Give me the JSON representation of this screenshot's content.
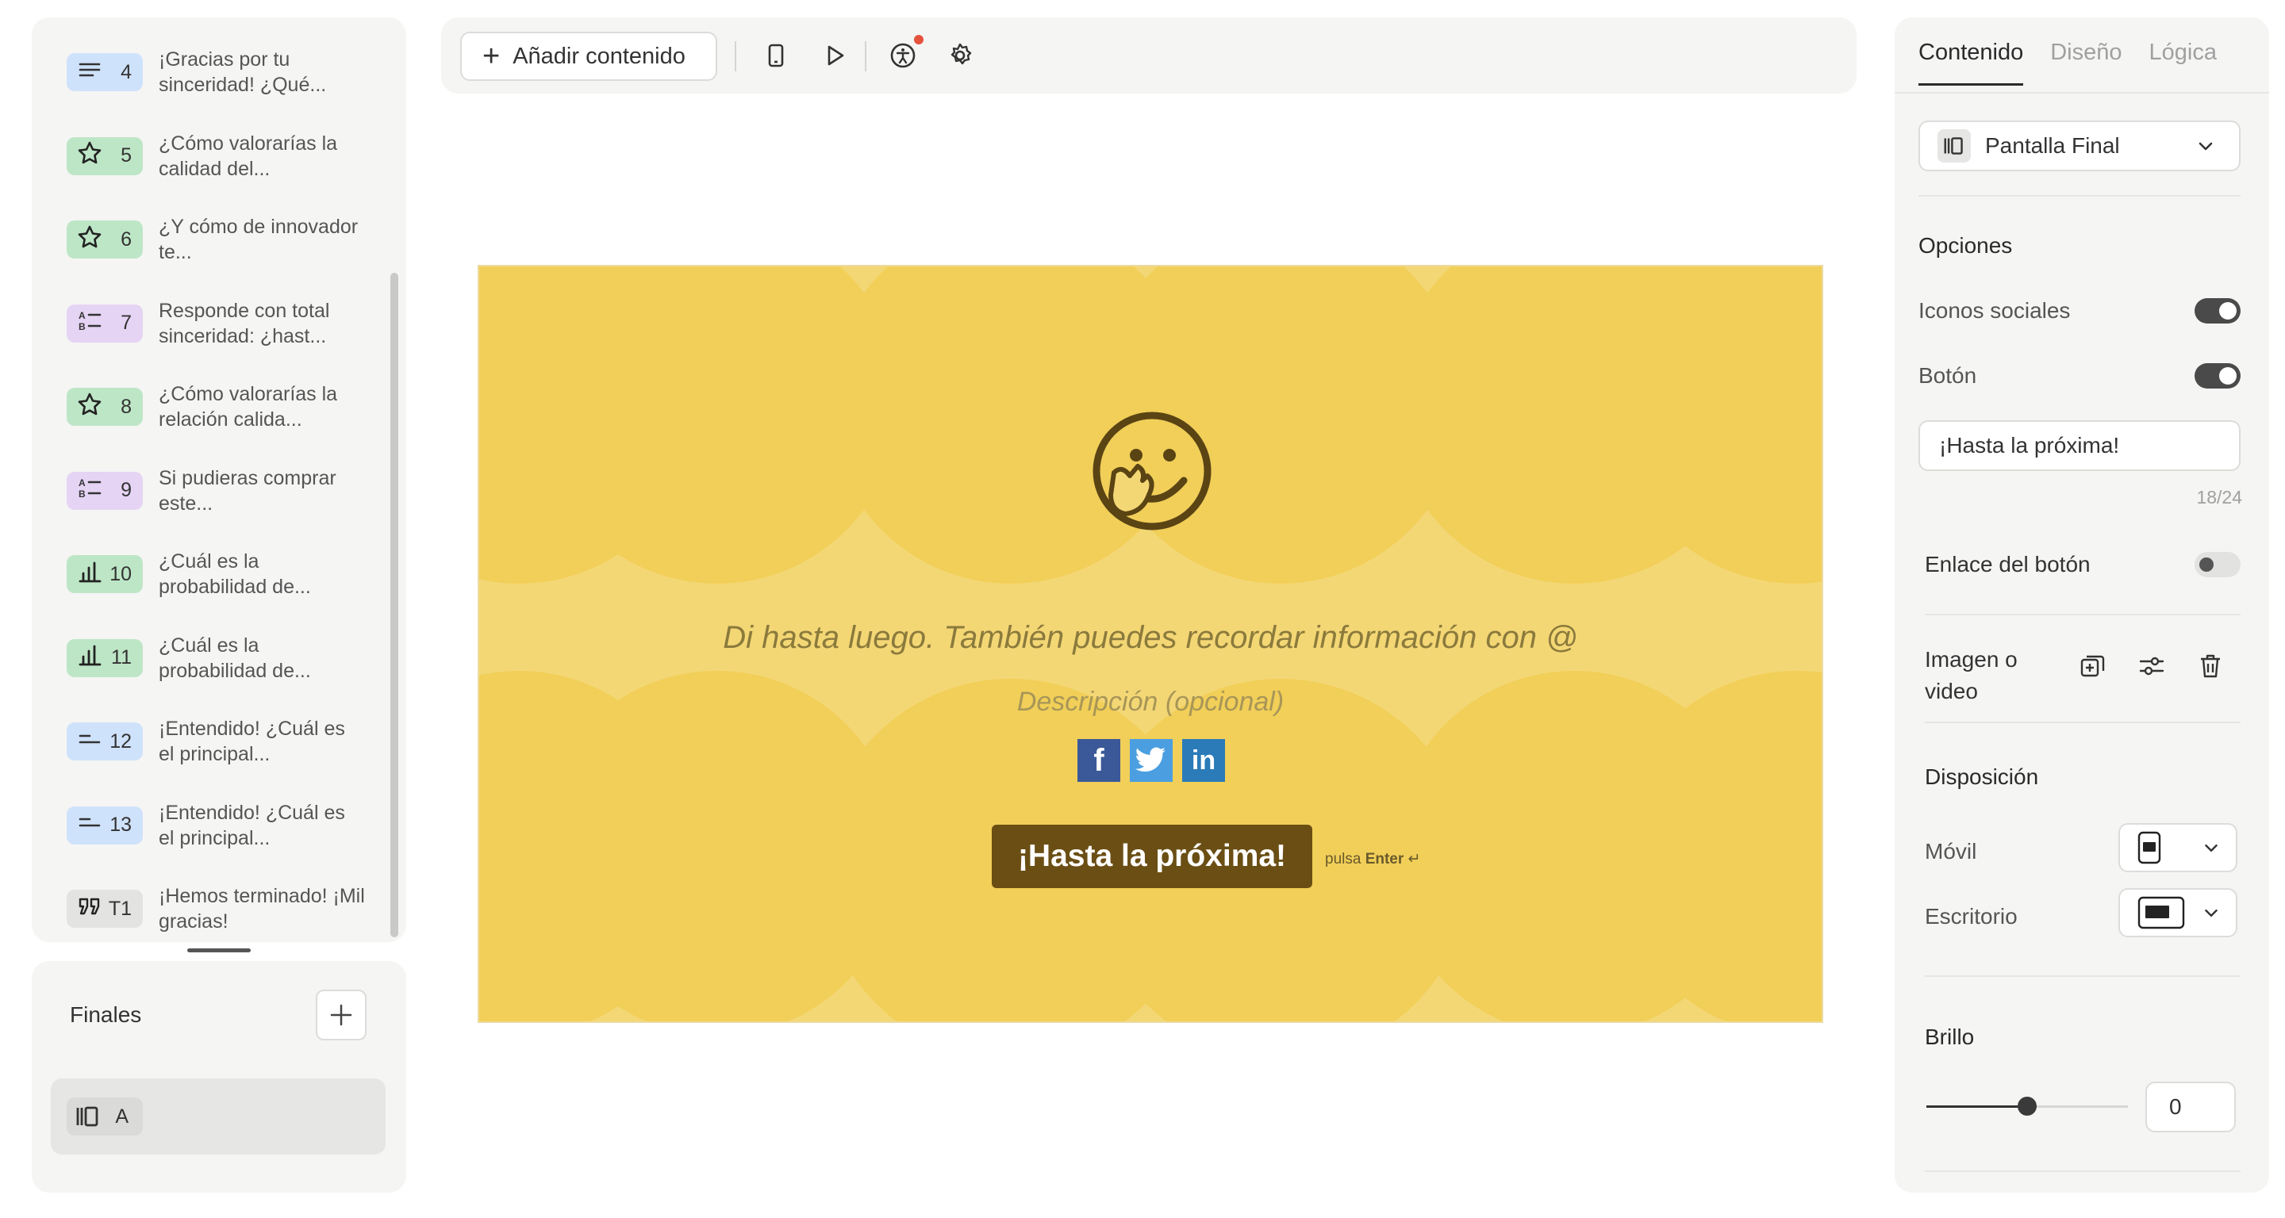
{
  "questions": [
    {
      "num": "4",
      "text": "¡Gracias por tu sinceridad! ¿Qué...",
      "icon": "text-lines-icon",
      "color": "blue"
    },
    {
      "num": "5",
      "text": "¿Cómo valorarías la calidad del...",
      "icon": "star-icon",
      "color": "green"
    },
    {
      "num": "6",
      "text": "¿Y cómo de innovador te...",
      "icon": "star-icon",
      "color": "green"
    },
    {
      "num": "7",
      "text": "Responde con total sinceridad: ¿hast...",
      "icon": "ranking-icon",
      "color": "purple"
    },
    {
      "num": "8",
      "text": "¿Cómo valorarías la relación calida...",
      "icon": "star-icon",
      "color": "green"
    },
    {
      "num": "9",
      "text": "Si pudieras comprar este...",
      "icon": "ranking-icon",
      "color": "purple"
    },
    {
      "num": "10",
      "text": "¿Cuál es la probabilidad de...",
      "icon": "bar-chart-icon",
      "color": "green"
    },
    {
      "num": "11",
      "text": "¿Cuál es la probabilidad de...",
      "icon": "bar-chart-icon",
      "color": "green"
    },
    {
      "num": "12",
      "text": "¡Entendido! ¿Cuál es el principal...",
      "icon": "short-text-icon",
      "color": "blue"
    },
    {
      "num": "13",
      "text": "¡Entendido! ¿Cuál es el principal...",
      "icon": "short-text-icon",
      "color": "blue"
    },
    {
      "num": "T1",
      "text": "¡Hemos terminado! ¡Mil gracias!",
      "icon": "quote-icon",
      "color": "grey"
    }
  ],
  "finals": {
    "title": "Finales",
    "item_label": "A"
  },
  "toolbar": {
    "add_content": "Añadir contenido"
  },
  "canvas": {
    "headline": "Di hasta luego. También puedes recordar información con @",
    "description": "Descripción (opcional)",
    "button": "¡Hasta la próxima!",
    "hint_prefix": "pulsa",
    "hint_key": "Enter",
    "hint_symbol": "↵",
    "background_color": "#f4d775",
    "shape_color": "#f1cf58",
    "button_color": "#6a4e14",
    "social": [
      "f",
      "t",
      "in"
    ]
  },
  "right_panel": {
    "tabs": [
      "Contenido",
      "Diseño",
      "Lógica"
    ],
    "screen_type": "Pantalla Final",
    "options_title": "Opciones",
    "social_icons_label": "Iconos sociales",
    "button_label": "Botón",
    "button_text_value": "¡Hasta la próxima!",
    "char_counter": "18/24",
    "button_link_label": "Enlace del botón",
    "media_label": "Imagen o video",
    "layout_title": "Disposición",
    "mobile_label": "Móvil",
    "desktop_label": "Escritorio",
    "brightness_title": "Brillo",
    "brightness_value": "0",
    "brightness_fraction": 0.5
  }
}
